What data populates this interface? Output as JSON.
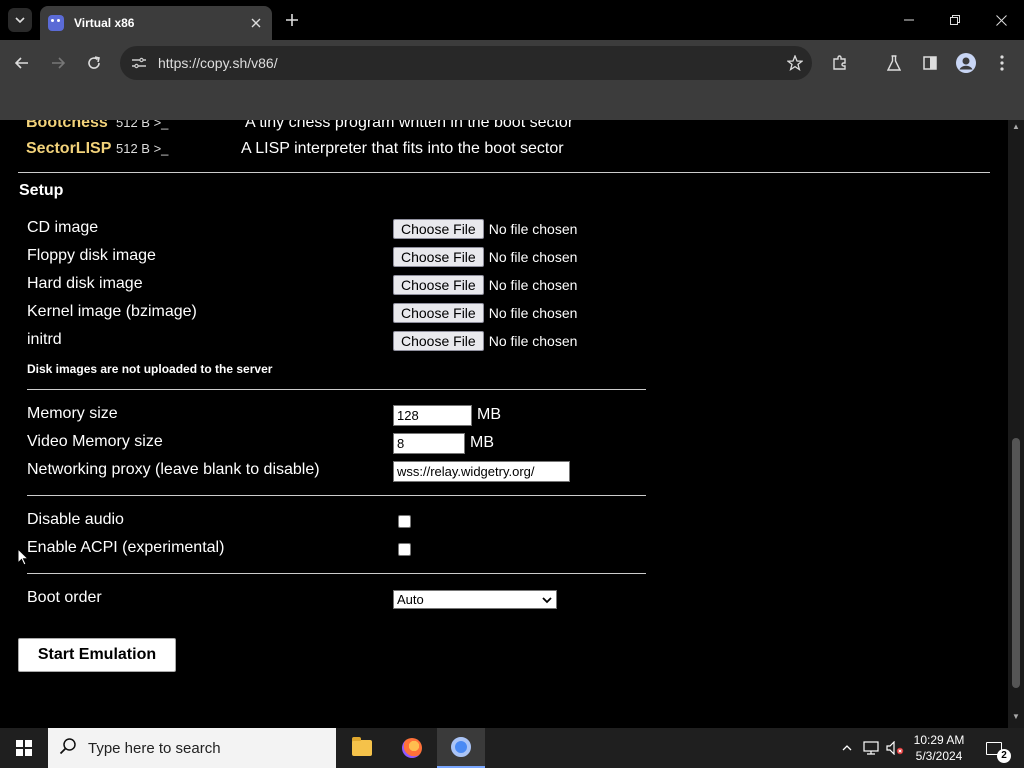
{
  "browser": {
    "tab_title": "Virtual x86",
    "url": "https://copy.sh/v86/"
  },
  "os_list": [
    {
      "name": "Bootchess",
      "size": "512 B >_",
      "desc": "A tiny chess program written in the boot sector"
    },
    {
      "name": "SectorLISP",
      "size": "512 B >_",
      "desc": "A LISP interpreter that fits into the boot sector"
    }
  ],
  "setup": {
    "title": "Setup",
    "file_inputs": [
      {
        "label": "CD image",
        "button": "Choose File",
        "status": "No file chosen"
      },
      {
        "label": "Floppy disk image",
        "button": "Choose File",
        "status": "No file chosen"
      },
      {
        "label": "Hard disk image",
        "button": "Choose File",
        "status": "No file chosen"
      },
      {
        "label": "Kernel image (bzimage)",
        "button": "Choose File",
        "status": "No file chosen"
      },
      {
        "label": "initrd",
        "button": "Choose File",
        "status": "No file chosen"
      }
    ],
    "note": "Disk images are not uploaded to the server",
    "memory": {
      "label": "Memory size",
      "value": "128",
      "unit": "MB"
    },
    "video_memory": {
      "label": "Video Memory size",
      "value": "8",
      "unit": "MB"
    },
    "proxy": {
      "label": "Networking proxy (leave blank to disable)",
      "value": "wss://relay.widgetry.org/"
    },
    "disable_audio": {
      "label": "Disable audio",
      "checked": false
    },
    "enable_acpi": {
      "label": "Enable ACPI (experimental)",
      "checked": false
    },
    "boot_order": {
      "label": "Boot order",
      "selected": "Auto"
    },
    "start_button": "Start Emulation"
  },
  "taskbar": {
    "search_placeholder": "Type here to search",
    "time": "10:29 AM",
    "date": "5/3/2024",
    "notification_count": "2"
  }
}
